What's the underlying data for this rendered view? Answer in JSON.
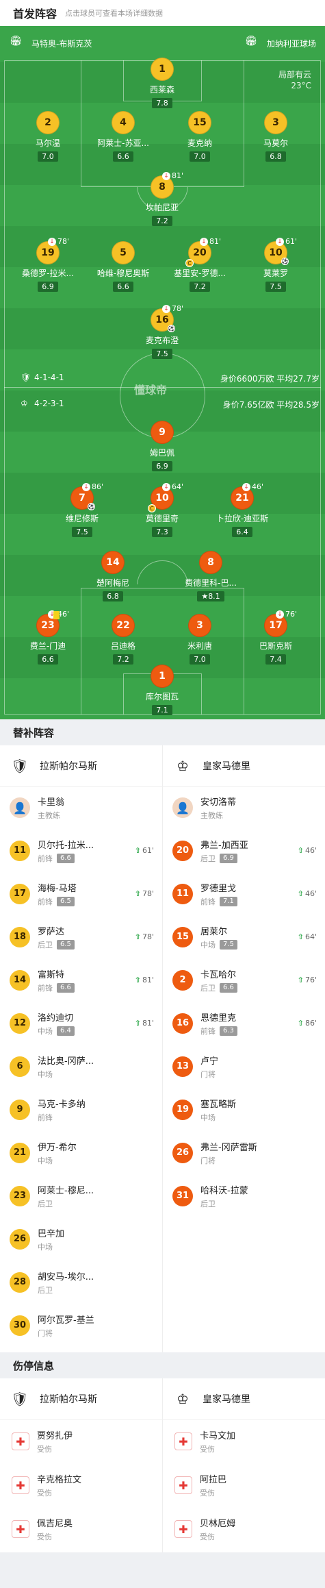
{
  "header": {
    "title": "首发阵容",
    "hint": "点击球员可查看本场详细数据"
  },
  "pitch": {
    "home_team": "马特奥-布斯克茨",
    "away_team": "加纳利亚球场",
    "weather": "局部有云",
    "temp": "23°C",
    "brand": "懂球帝",
    "home_formation": "4-1-4-1",
    "away_formation": "4-2-3-1",
    "home_value": "身价6600万欧  平均27.7岁",
    "away_value": "身价7.65亿欧  平均28.5岁",
    "home_players": [
      {
        "no": "1",
        "name": "西莱森",
        "rating": "7.8"
      },
      {
        "no": "2",
        "name": "马尔温",
        "rating": "7.0"
      },
      {
        "no": "4",
        "name": "阿莱士-苏亚...",
        "rating": "6.6"
      },
      {
        "no": "15",
        "name": "麦克纳",
        "rating": "7.0"
      },
      {
        "no": "3",
        "name": "马莫尔",
        "rating": "6.8"
      },
      {
        "no": "8",
        "name": "坎帕尼亚",
        "rating": "7.2",
        "sub": "81'"
      },
      {
        "no": "19",
        "name": "桑德罗-拉米...",
        "rating": "6.9",
        "sub": "78'"
      },
      {
        "no": "5",
        "name": "哈维-穆尼奥斯",
        "rating": "6.6"
      },
      {
        "no": "20",
        "name": "基里安-罗德...",
        "rating": "7.2",
        "sub": "81'",
        "captain": "C"
      },
      {
        "no": "10",
        "name": "莫莱罗",
        "rating": "7.5",
        "sub": "61'",
        "goal": "⚽"
      },
      {
        "no": "16",
        "name": "麦克布澄",
        "rating": "7.5",
        "sub": "78'",
        "goal": "⚽"
      }
    ],
    "away_players": [
      {
        "no": "9",
        "name": "姆巴佩",
        "rating": "6.9"
      },
      {
        "no": "7",
        "name": "维尼修斯",
        "rating": "7.5",
        "sub": "86'",
        "goal": "⚽"
      },
      {
        "no": "10",
        "name": "莫德里奇",
        "rating": "7.3",
        "sub": "64'",
        "captain": "C"
      },
      {
        "no": "21",
        "name": "卜拉欣-迪亚斯",
        "rating": "6.4",
        "sub": "46'"
      },
      {
        "no": "14",
        "name": "楚阿梅尼",
        "rating": "6.8"
      },
      {
        "no": "8",
        "name": "费德里科-巴...",
        "rating": "8.1",
        "star": "★"
      },
      {
        "no": "23",
        "name": "费兰-门迪",
        "rating": "6.6",
        "sub": "46'"
      },
      {
        "no": "22",
        "name": "吕迪格",
        "rating": "7.2"
      },
      {
        "no": "3",
        "name": "米利唐",
        "rating": "7.0"
      },
      {
        "no": "17",
        "name": "巴斯克斯",
        "rating": "7.4",
        "sub": "76'"
      },
      {
        "no": "1",
        "name": "库尔图瓦",
        "rating": "7.1"
      }
    ]
  },
  "subs": {
    "title": "替补阵容",
    "home_team": "拉斯帕尔马斯",
    "away_team": "皇家马德里",
    "home_coach": {
      "name": "卡里翁",
      "role": "主教练"
    },
    "away_coach": {
      "name": "安切洛蒂",
      "role": "主教练"
    },
    "home": [
      {
        "no": "11",
        "name": "贝尔托-拉米...",
        "pos": "前锋",
        "rating": "6.6",
        "on": "61'"
      },
      {
        "no": "17",
        "name": "海梅-马塔",
        "pos": "前锋",
        "rating": "6.5",
        "on": "78'"
      },
      {
        "no": "18",
        "name": "罗萨达",
        "pos": "后卫",
        "rating": "6.5",
        "on": "78'"
      },
      {
        "no": "14",
        "name": "富斯特",
        "pos": "前锋",
        "rating": "6.6",
        "on": "81'"
      },
      {
        "no": "12",
        "name": "洛约迪切",
        "pos": "中场",
        "rating": "6.4",
        "on": "81'"
      },
      {
        "no": "6",
        "name": "法比奥-冈萨...",
        "pos": "中场"
      },
      {
        "no": "9",
        "name": "马克-卡多纳",
        "pos": "前锋"
      },
      {
        "no": "21",
        "name": "伊万-希尔",
        "pos": "中场"
      },
      {
        "no": "23",
        "name": "阿莱士-穆尼...",
        "pos": "后卫"
      },
      {
        "no": "26",
        "name": "巴辛加",
        "pos": "中场"
      },
      {
        "no": "28",
        "name": "胡安马-埃尔...",
        "pos": "后卫"
      },
      {
        "no": "30",
        "name": "阿尔瓦罗-基兰",
        "pos": "门将"
      }
    ],
    "away": [
      {
        "no": "20",
        "name": "弗兰-加西亚",
        "pos": "后卫",
        "rating": "6.9",
        "on": "46'"
      },
      {
        "no": "11",
        "name": "罗德里戈",
        "pos": "前锋",
        "rating": "7.1",
        "on": "46'"
      },
      {
        "no": "15",
        "name": "居莱尔",
        "pos": "中场",
        "rating": "7.5",
        "on": "64'"
      },
      {
        "no": "2",
        "name": "卡瓦哈尔",
        "pos": "后卫",
        "rating": "6.6",
        "on": "76'"
      },
      {
        "no": "16",
        "name": "恩德里克",
        "pos": "前锋",
        "rating": "6.3",
        "on": "86'"
      },
      {
        "no": "13",
        "name": "卢宁",
        "pos": "门将"
      },
      {
        "no": "19",
        "name": "塞瓦略斯",
        "pos": "中场"
      },
      {
        "no": "26",
        "name": "弗兰-冈萨雷斯",
        "pos": "门将"
      },
      {
        "no": "31",
        "name": "哈科沃-拉蒙",
        "pos": "后卫"
      }
    ]
  },
  "injuries": {
    "title": "伤停信息",
    "home_team": "拉斯帕尔马斯",
    "away_team": "皇家马德里",
    "home": [
      {
        "name": "贾努扎伊",
        "status": "受伤"
      },
      {
        "name": "辛克格拉文",
        "status": "受伤"
      },
      {
        "name": "佩吉尼奥",
        "status": "受伤"
      }
    ],
    "away": [
      {
        "name": "卡马文加",
        "status": "受伤"
      },
      {
        "name": "阿拉巴",
        "status": "受伤"
      },
      {
        "name": "贝林厄姆",
        "status": "受伤"
      }
    ]
  },
  "colors": {
    "pitch": "#3aa54a",
    "home": "#f6c126",
    "away": "#ee5b10",
    "sub_up": "#2ea84a"
  }
}
